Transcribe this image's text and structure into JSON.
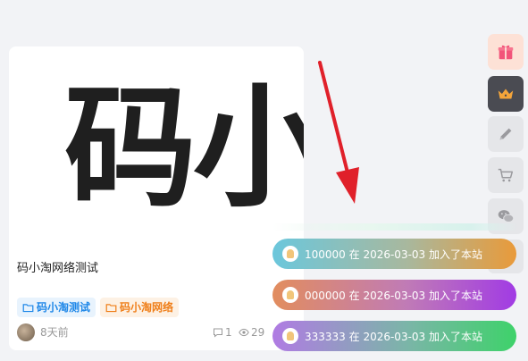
{
  "post": {
    "cover_text": "码小",
    "title": "码小淘网络测试",
    "tags": [
      "码小淘测试",
      "码小淘网络"
    ],
    "time": "8天前",
    "comments": "1",
    "views": "29"
  },
  "sidebar": {
    "items": [
      {
        "icon": "gift-icon",
        "bg": "#fde1d6"
      },
      {
        "icon": "crown-icon",
        "bg": "#4a4b52"
      },
      {
        "icon": "pencil-icon",
        "bg": "#e5e6e9"
      },
      {
        "icon": "cart-icon",
        "bg": "#e5e6e9"
      },
      {
        "icon": "wechat-icon",
        "bg": "#e5e6e9"
      }
    ]
  },
  "notifications": [
    {
      "text": "100000 在 2026-03-03 加入了本站"
    },
    {
      "text": "000000 在 2026-03-03 加入了本站"
    },
    {
      "text": "333333 在 2026-03-03 加入了本站"
    }
  ],
  "colors": {
    "tag_blue": "#1e87e8",
    "tag_orange": "#ef7f1a",
    "arrow": "#e0202a"
  }
}
